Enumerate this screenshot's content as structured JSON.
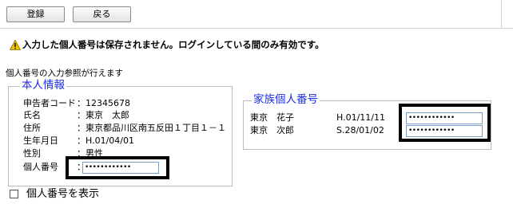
{
  "toolbar": {
    "register_label": "登録",
    "back_label": "戻る"
  },
  "warning": {
    "icon": "warning-icon",
    "text": "入力した個人番号は保存されません。ログインしている間のみ有効です。"
  },
  "subheading": "個人番号の入力参照が行えます",
  "personal": {
    "legend": "本人情報",
    "rows": [
      {
        "label": "申告者コード",
        "value": "：12345678"
      },
      {
        "label": "氏名",
        "value": "：東京　太郎"
      },
      {
        "label": "住所",
        "value": "：東京都品川区南五反田１丁目１－１"
      },
      {
        "label": "生年月日",
        "value": "：H.01/04/01"
      },
      {
        "label": "性別",
        "value": "：男性"
      },
      {
        "label": "個人番号",
        "value": "："
      }
    ],
    "number_masked": "••••••••••••"
  },
  "family": {
    "legend": "家族個人番号",
    "members": [
      {
        "name": "東京　花子",
        "birth": "H.01/11/11",
        "number_masked": "••••••••••••"
      },
      {
        "name": "東京　次郎",
        "birth": "S.28/01/02",
        "number_masked": "••••••••••••"
      }
    ]
  },
  "show_number": {
    "label": "個人番号を表示",
    "checked": false
  },
  "colors": {
    "legend_blue": "#1a2ee6",
    "highlight": "#000000",
    "input_border": "#7a9cc8"
  }
}
